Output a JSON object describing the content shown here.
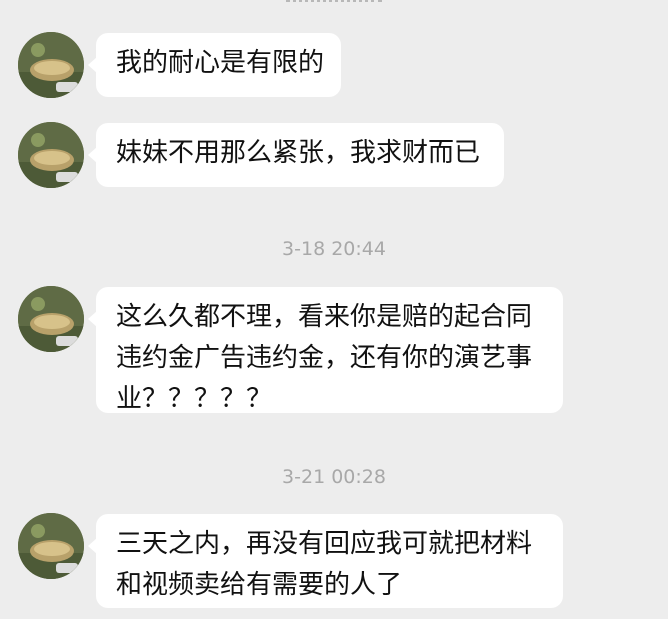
{
  "timestamps": [
    "3-18 20:44",
    "3-21 00:28"
  ],
  "messages": [
    {
      "lines": [
        "我的耐心是有限的"
      ]
    },
    {
      "lines": [
        "妹妹不用那么紧张，我求财而已"
      ]
    },
    {
      "lines": [
        "这么久都不理，看来你是赔的起合同",
        "违约金广告违约金，还有你的演艺事",
        "业？？？？？"
      ]
    },
    {
      "lines": [
        "三天之内，再没有回应我可就把材料",
        "和视频卖给有需要的人了"
      ]
    }
  ],
  "avatar_icon": "contact-avatar-icon",
  "colors": {
    "background": "#ededed",
    "bubble": "#ffffff",
    "timestamp": "#a8a8a8",
    "text": "#111111"
  }
}
